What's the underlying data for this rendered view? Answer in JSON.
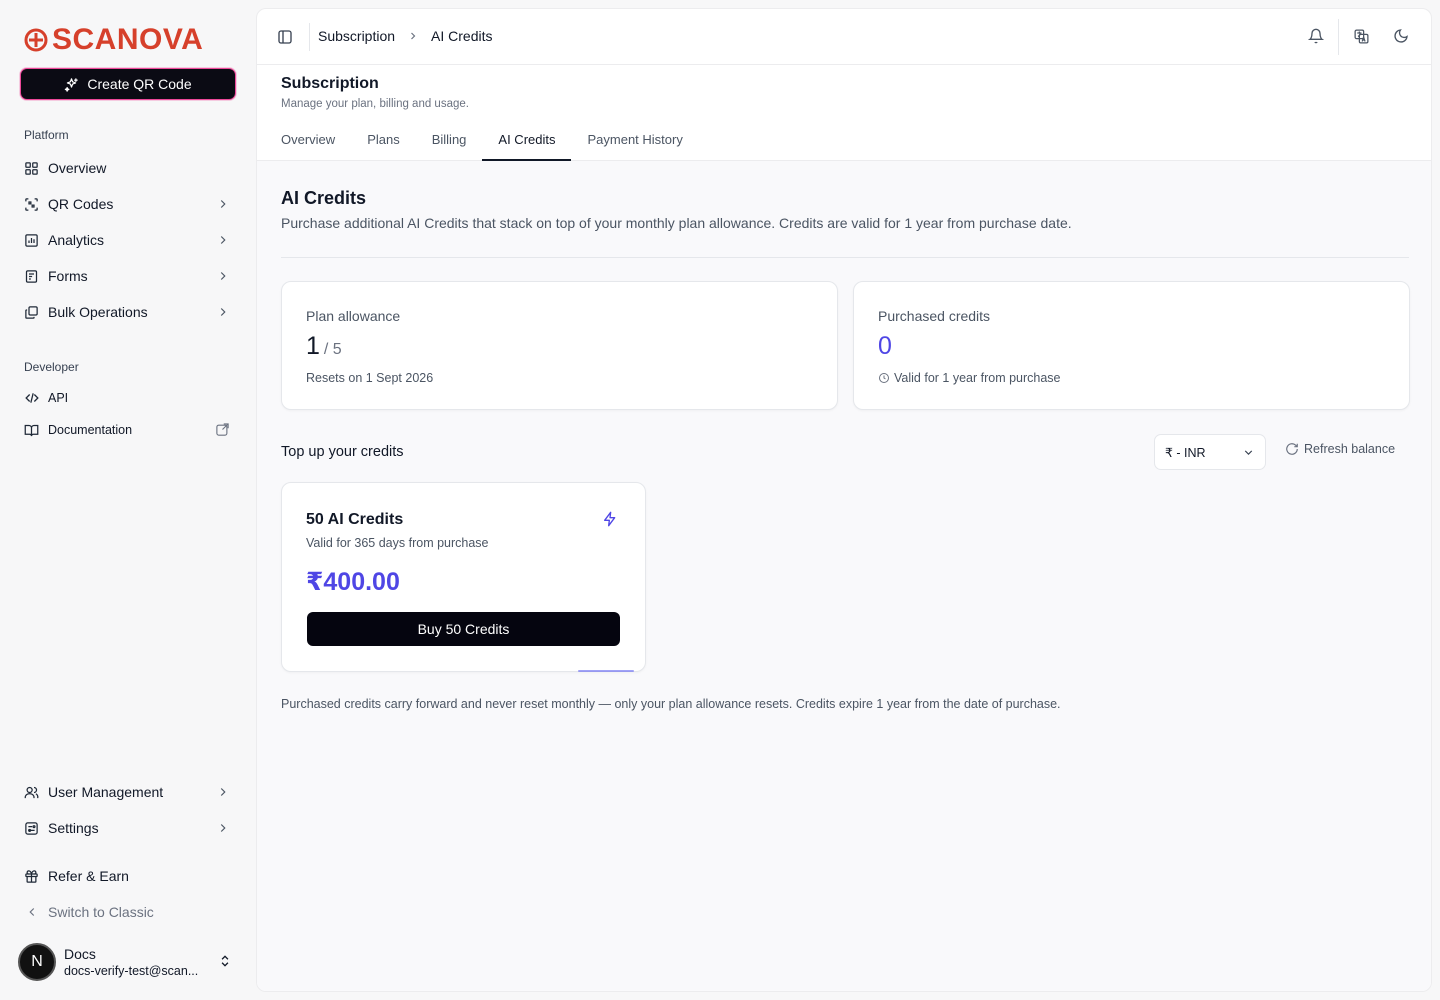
{
  "brand": {
    "name": "SCANOVA",
    "color": "#d6402b"
  },
  "sidebar": {
    "create_button": "Create QR Code",
    "platform_label": "Platform",
    "platform_items": [
      {
        "label": "Overview",
        "icon": "grid-icon"
      },
      {
        "label": "QR Codes",
        "icon": "qr-scan-icon"
      },
      {
        "label": "Analytics",
        "icon": "bar-chart-icon"
      },
      {
        "label": "Forms",
        "icon": "form-icon"
      },
      {
        "label": "Bulk Operations",
        "icon": "layers-icon"
      }
    ],
    "developer_label": "Developer",
    "developer_items": [
      {
        "label": "API",
        "icon": "code-icon"
      },
      {
        "label": "Documentation",
        "icon": "book-icon"
      }
    ],
    "bottom_items": [
      {
        "label": "User Management",
        "icon": "users-icon"
      },
      {
        "label": "Settings",
        "icon": "settings-icon"
      },
      {
        "label": "Refer & Earn",
        "icon": "gift-icon"
      },
      {
        "label": "Switch to Classic",
        "icon": "chevron-left-icon"
      }
    ],
    "user": {
      "initial": "N",
      "name": "Docs",
      "email": "docs-verify-test@scan..."
    }
  },
  "topbar": {
    "breadcrumb": [
      "Subscription",
      "AI Credits"
    ],
    "icons": [
      "bell-icon",
      "translate-icon",
      "moon-icon"
    ]
  },
  "page": {
    "title": "Subscription",
    "subtitle": "Manage your plan, billing and usage.",
    "tabs": [
      "Overview",
      "Plans",
      "Billing",
      "AI Credits",
      "Payment History"
    ],
    "active_tab": "AI Credits"
  },
  "credits": {
    "title": "AI Credits",
    "description": "Purchase additional AI Credits that stack on top of your monthly plan allowance. Credits are valid for 1 year from purchase date.",
    "plan_allowance": {
      "label": "Plan allowance",
      "used": "1",
      "total": "/ 5",
      "footer": "Resets on 1 Sept 2026"
    },
    "purchased": {
      "label": "Purchased credits",
      "value": "0",
      "footer": "Valid for 1 year from purchase"
    },
    "topup_label": "Top up your credits",
    "currency": "₹ - INR",
    "refresh_label": "Refresh balance",
    "pack": {
      "title": "50 AI Credits",
      "subtitle": "Valid for 365 days from purchase",
      "price": "₹400.00",
      "button": "Buy 50 Credits"
    },
    "footnote": "Purchased credits carry forward and never reset monthly — only your plan allowance resets. Credits expire 1 year from the date of purchase."
  },
  "colors": {
    "accent": "#4f46e5",
    "primary_button": "#05050f"
  }
}
